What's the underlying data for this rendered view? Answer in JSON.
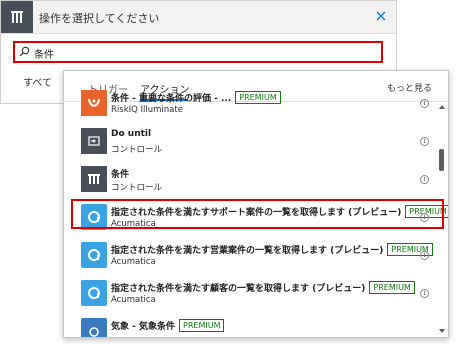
{
  "dialog": {
    "title": "操作を選択してください",
    "search_value": "条件",
    "tab_all": "すべて"
  },
  "panel": {
    "tabs": [
      {
        "label": "トリガー",
        "active": false
      },
      {
        "label": "アクション",
        "active": true
      }
    ],
    "more_label": "もっと見る",
    "rows": [
      {
        "name": "条件 - 重要な条件の評価 - ...",
        "subtitle": "RiskIQ Illuminate",
        "badge": "PREMIUM",
        "icon": "riskiq-icon"
      },
      {
        "name": "Do until",
        "subtitle": "コントロール",
        "badge": "",
        "icon": "loop-icon"
      },
      {
        "name": "条件",
        "subtitle": "コントロール",
        "badge": "",
        "icon": "condition-icon"
      },
      {
        "name": "指定された条件を満たすサポート案件の一覧を取得します (プレビュー)",
        "subtitle": "Acumatica",
        "badge": "PREMIUM",
        "icon": "acumatica-icon"
      },
      {
        "name": "指定された条件を満たす営業案件の一覧を取得します (プレビュー)",
        "subtitle": "Acumatica",
        "badge": "PREMIUM",
        "icon": "acumatica-icon"
      },
      {
        "name": "指定された条件を満たす顧客の一覧を取得します (プレビュー)",
        "subtitle": "Acumatica",
        "badge": "PREMIUM",
        "icon": "acumatica-icon"
      },
      {
        "name": "気象 - 気象条件",
        "subtitle": "",
        "badge": "PREMIUM",
        "icon": "weather-icon"
      }
    ]
  },
  "colors": {
    "accent": "#0078d4",
    "highlight": "#e00000",
    "premium": "#107c10",
    "control": "#484f58",
    "riskiq": "#e8642a",
    "acumatica": "#3aa3e3",
    "weather": "#3a7bbf"
  }
}
